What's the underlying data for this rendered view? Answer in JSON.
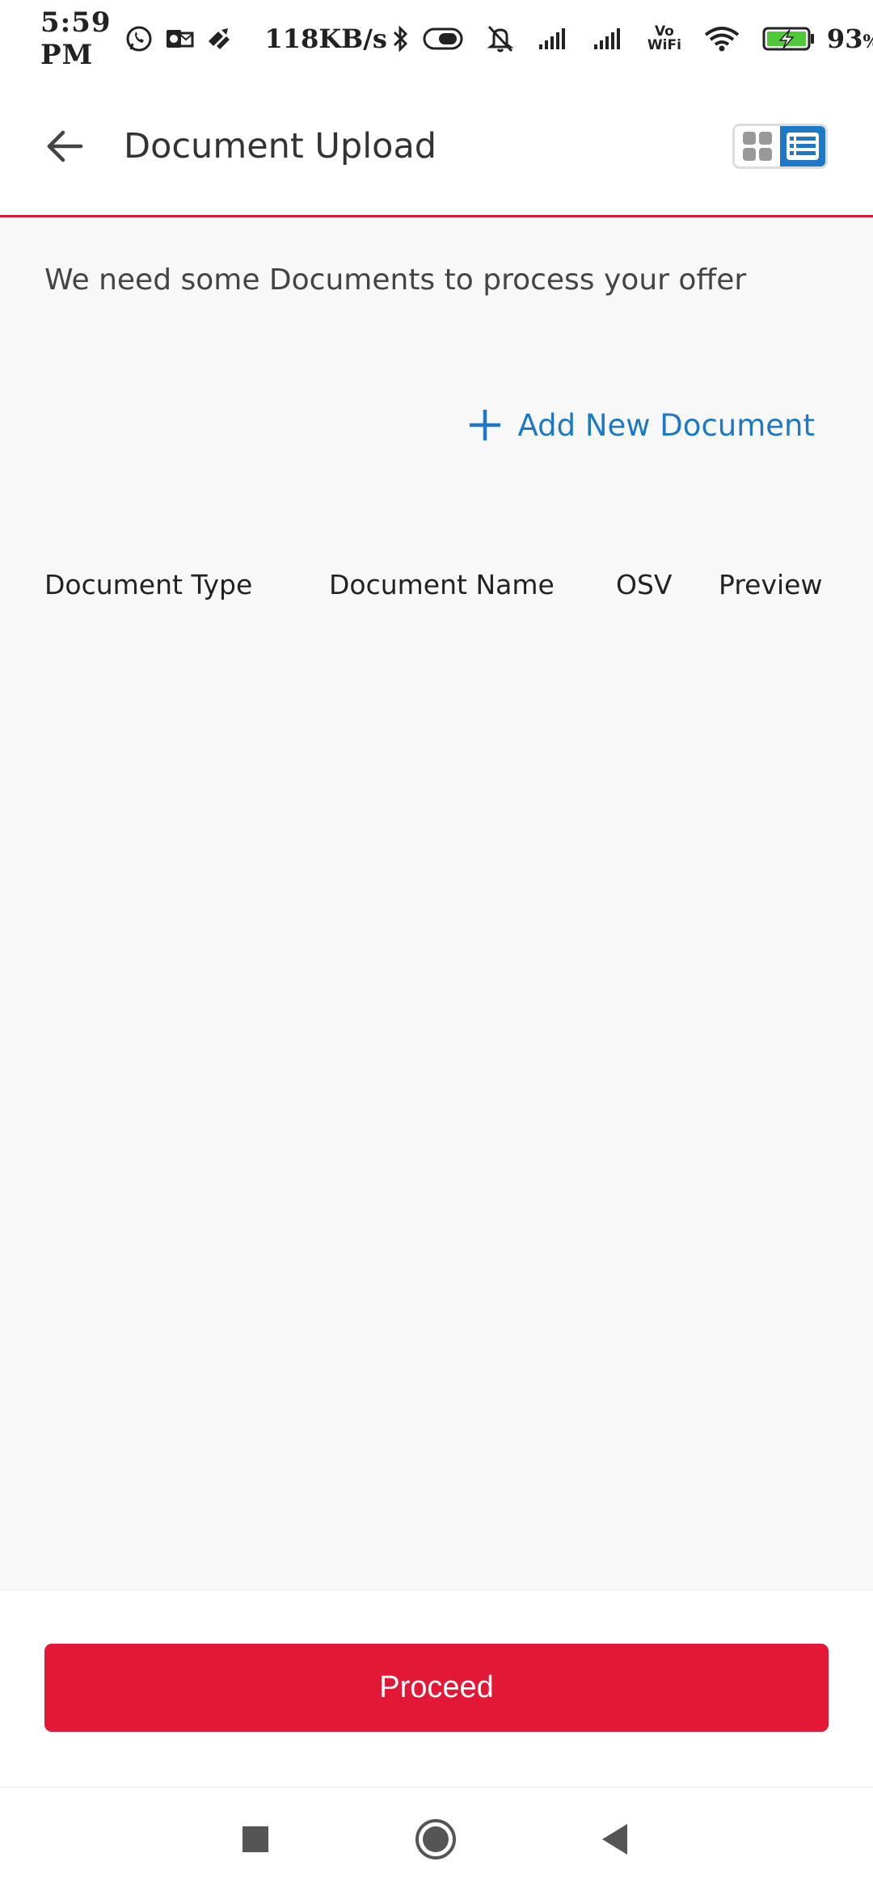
{
  "status_bar": {
    "time": "5:59 PM",
    "net_speed": "118KB/s",
    "vowifi_top": "Vo",
    "vowifi_bottom": "WiFi",
    "battery_percent": "93",
    "battery_unit": "%",
    "icons": [
      "whatsapp-icon",
      "outlook-icon",
      "app-icon",
      "bluetooth-icon",
      "toggle-icon",
      "mute-icon",
      "signal-icon",
      "signal-icon",
      "vowifi-icon",
      "wifi-icon",
      "battery-charging-icon"
    ]
  },
  "app_bar": {
    "title": "Document Upload",
    "back_icon": "arrow-left-icon",
    "view_toggle": {
      "options": [
        "grid-view-icon",
        "list-view-icon"
      ],
      "selected": "list-view-icon"
    }
  },
  "main": {
    "intro_text": "We need some Documents to process your offer",
    "add_document_label": "Add New Document",
    "table": {
      "columns": [
        "Document Type",
        "Document Name",
        "OSV",
        "Preview"
      ],
      "rows": []
    }
  },
  "footer": {
    "proceed_label": "Proceed"
  },
  "nav_bar": {
    "buttons": [
      "recents-square-icon",
      "home-circle-icon",
      "back-triangle-icon"
    ]
  },
  "colors": {
    "accent_red": "#e31837",
    "link_blue": "#1d79c6",
    "background": "#f8f8f8"
  }
}
